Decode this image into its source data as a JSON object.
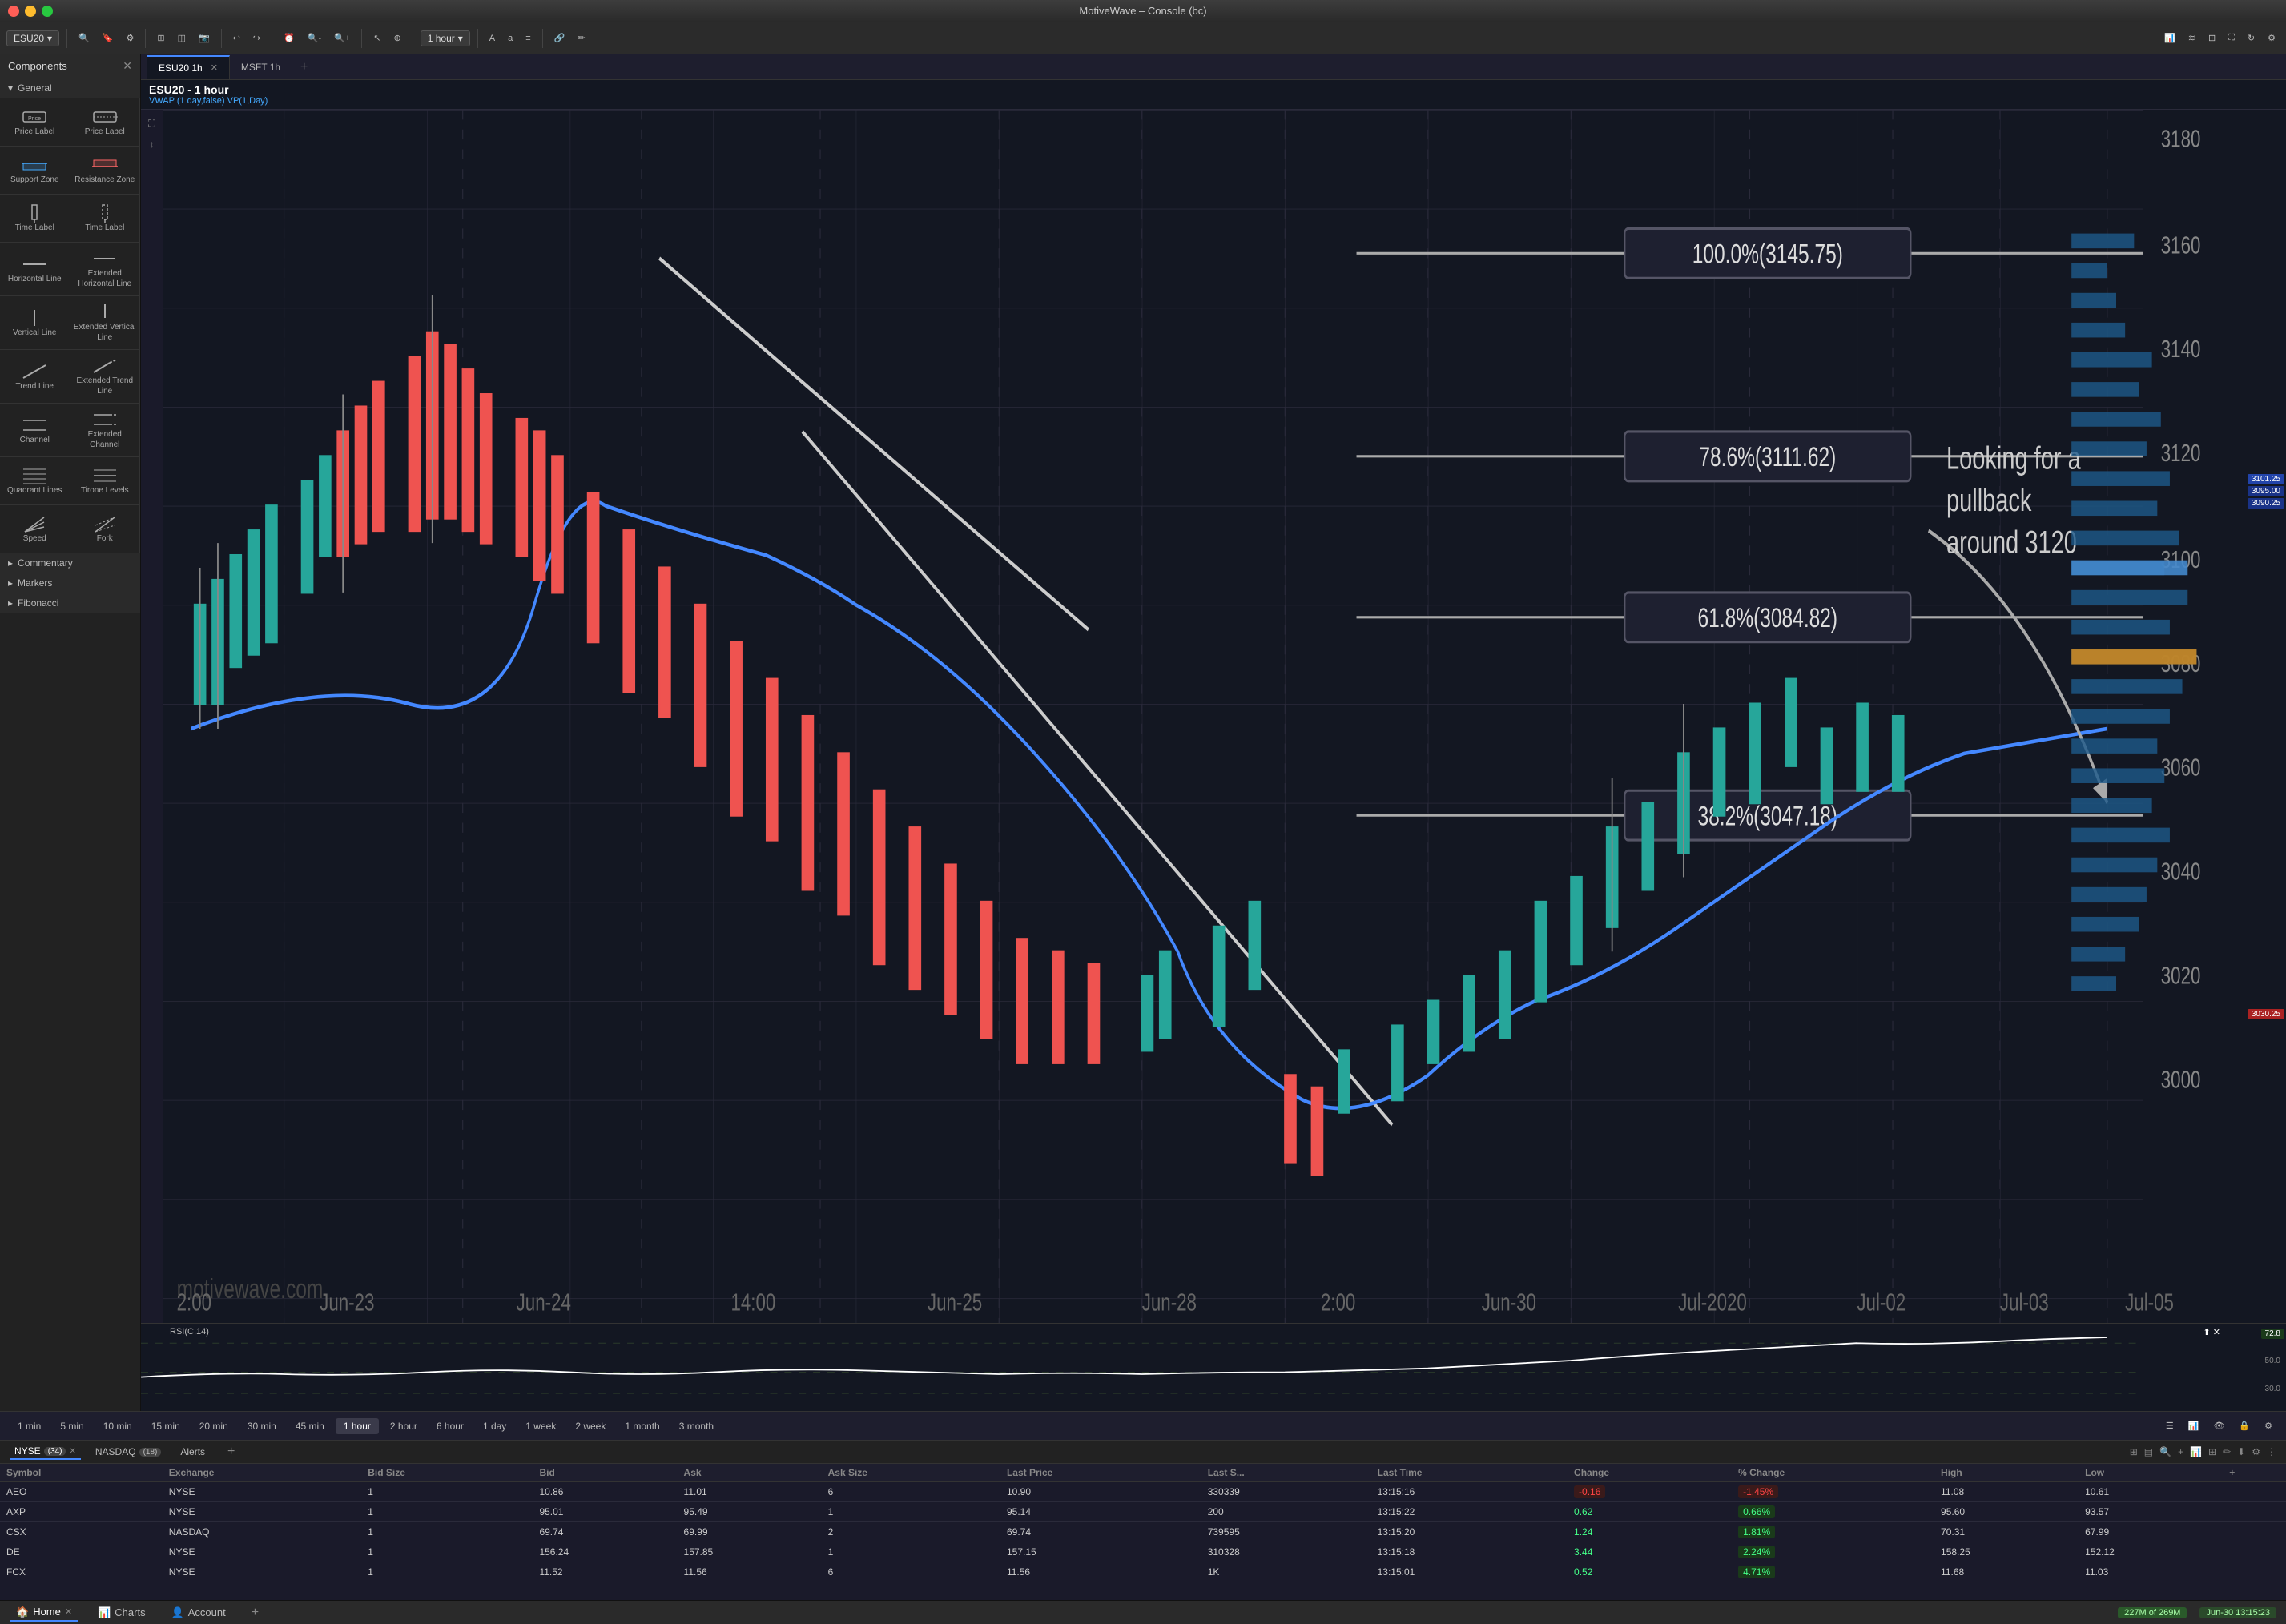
{
  "app": {
    "title": "MotiveWave – Console (bc)"
  },
  "titlebar": {
    "title": "MotiveWave – Console (bc)"
  },
  "toolbar": {
    "symbol": "ESU20",
    "timeframe": "1 hour",
    "timeframe_label": "hour"
  },
  "tabs": {
    "items": [
      {
        "label": "ESU20 1h",
        "active": true
      },
      {
        "label": "MSFT 1h",
        "active": false
      }
    ],
    "add_label": "+"
  },
  "chart": {
    "title": "ESU20 - 1 hour",
    "subtitle": "VWAP (1 day,false) VP(1,Day)",
    "fib_levels": [
      {
        "label": "100.0%(3145.75)",
        "y_pct": 18
      },
      {
        "label": "78.6%(3111.62)",
        "y_pct": 31
      },
      {
        "label": "61.8%(3084.82)",
        "y_pct": 42
      },
      {
        "label": "38.2%(3047.18)",
        "y_pct": 55
      }
    ],
    "annotation": "Looking for a\npullback\naround 3120",
    "watermark": "motivewave.com",
    "price_axis": {
      "values": [
        3180,
        3160,
        3140,
        3120,
        3100,
        3080,
        3060,
        3040,
        3020,
        3000
      ]
    },
    "current_price_badges": [
      {
        "value": "3101.25",
        "color": "blue"
      },
      {
        "value": "3095.00",
        "color": "blue"
      },
      {
        "value": "3090.25",
        "color": "blue"
      },
      {
        "value": "3030.25",
        "color": "red"
      }
    ],
    "x_axis": [
      "2:00",
      "Jun-23",
      "Jun-24",
      "14:00",
      "Jun-25",
      "Jun-28",
      "2:00",
      "Jun-30",
      "Jul-2020",
      "Jul-02",
      "Jul-03",
      "Jul-05"
    ]
  },
  "rsi": {
    "label": "RSI(C,14)",
    "value": "72.8",
    "levels": [
      72.8,
      50.0,
      30.0
    ]
  },
  "time_nav": {
    "buttons": [
      "1 min",
      "5 min",
      "10 min",
      "15 min",
      "20 min",
      "30 min",
      "45 min",
      "1 hour",
      "2 hour",
      "6 hour",
      "1 day",
      "1 week",
      "2 week",
      "1 month",
      "3 month"
    ],
    "active": "1 hour"
  },
  "sidebar": {
    "title": "Components",
    "sections": [
      {
        "name": "General",
        "items": [
          {
            "id": "price-label-1",
            "label": "Price Label",
            "icon": "price-label"
          },
          {
            "id": "price-label-2",
            "label": "Price Label",
            "icon": "price-label"
          },
          {
            "id": "support-zone",
            "label": "Support\nZone",
            "icon": "support"
          },
          {
            "id": "resistance-zone",
            "label": "Resistance\nZone",
            "icon": "resistance"
          },
          {
            "id": "time-label-1",
            "label": "Time Label",
            "icon": "time-label"
          },
          {
            "id": "time-label-2",
            "label": "Time Label",
            "icon": "time-label"
          },
          {
            "id": "horizontal-line",
            "label": "Horizontal\nLine",
            "icon": "hline"
          },
          {
            "id": "ext-horizontal-line",
            "label": "Extended\nHorizontal\nLine",
            "icon": "ext-hline"
          },
          {
            "id": "vertical-line",
            "label": "Vertical Line",
            "icon": "vline"
          },
          {
            "id": "ext-vertical-line",
            "label": "Extended\nVertical Line",
            "icon": "ext-vline"
          },
          {
            "id": "trend-line",
            "label": "Trend Line",
            "icon": "trendline"
          },
          {
            "id": "ext-trend-line",
            "label": "Extended\nTrend Line",
            "icon": "ext-trendline"
          },
          {
            "id": "channel",
            "label": "Channel",
            "icon": "channel"
          },
          {
            "id": "ext-channel",
            "label": "Extended\nChannel",
            "icon": "ext-channel"
          },
          {
            "id": "quadrant-lines",
            "label": "Quadrant\nLines",
            "icon": "quadrant"
          },
          {
            "id": "tirone-levels",
            "label": "Tirone\nLevels",
            "icon": "tirone"
          },
          {
            "id": "speed",
            "label": "Speed",
            "icon": "speed"
          },
          {
            "id": "fork",
            "label": "Fork",
            "icon": "fork"
          }
        ]
      },
      {
        "name": "Commentary",
        "items": []
      },
      {
        "name": "Markers",
        "items": []
      },
      {
        "name": "Fibonacci",
        "items": []
      }
    ]
  },
  "watchlist": {
    "tabs": [
      {
        "label": "NYSE",
        "count": 34,
        "active": true
      },
      {
        "label": "NASDAQ",
        "count": 18,
        "active": false
      },
      {
        "label": "Alerts",
        "count": null,
        "active": false
      }
    ],
    "columns": [
      "Symbol",
      "Exchange",
      "Bid Size",
      "Bid",
      "Ask",
      "Ask Size",
      "Last Price",
      "Last S...",
      "Last Time",
      "Change",
      "% Change",
      "High",
      "Low"
    ],
    "rows": [
      {
        "symbol": "AEO",
        "exchange": "NYSE",
        "bid_size": "1",
        "bid": "10.86",
        "ask": "11.01",
        "ask_size": "6",
        "last_price": "10.90",
        "last_s": "330339",
        "last_time": "13:15:16",
        "change": "-0.16",
        "pct_change": "-1.45%",
        "high": "11.08",
        "low": "10.61",
        "change_type": "neg"
      },
      {
        "symbol": "AXP",
        "exchange": "NYSE",
        "bid_size": "1",
        "bid": "95.01",
        "ask": "95.49",
        "ask_size": "1",
        "last_price": "95.14",
        "last_s": "200",
        "last_time": "13:15:22",
        "change": "0.62",
        "pct_change": "0.66%",
        "high": "95.60",
        "low": "93.57",
        "change_type": "pos"
      },
      {
        "symbol": "CSX",
        "exchange": "NASDAQ",
        "bid_size": "1",
        "bid": "69.74",
        "ask": "69.99",
        "ask_size": "2",
        "last_price": "69.74",
        "last_s": "739595",
        "last_time": "13:15:20",
        "change": "1.24",
        "pct_change": "1.81%",
        "high": "70.31",
        "low": "67.99",
        "change_type": "pos"
      },
      {
        "symbol": "DE",
        "exchange": "NYSE",
        "bid_size": "1",
        "bid": "156.24",
        "ask": "157.85",
        "ask_size": "1",
        "last_price": "157.15",
        "last_s": "310328",
        "last_time": "13:15:18",
        "change": "3.44",
        "pct_change": "2.24%",
        "high": "158.25",
        "low": "152.12",
        "change_type": "pos"
      },
      {
        "symbol": "FCX",
        "exchange": "NYSE",
        "bid_size": "1",
        "bid": "11.52",
        "ask": "11.56",
        "ask_size": "6",
        "last_price": "11.56",
        "last_s": "1K",
        "last_time": "13:15:01",
        "change": "0.52",
        "pct_change": "4.71%",
        "high": "11.68",
        "low": "11.03",
        "change_type": "pos"
      }
    ]
  },
  "bottom_bar": {
    "tabs": [
      {
        "label": "Home",
        "icon": "home",
        "closeable": true,
        "active": true
      },
      {
        "label": "Charts",
        "icon": "charts",
        "closeable": false,
        "active": false
      },
      {
        "label": "Account",
        "icon": "account",
        "closeable": false,
        "active": false
      }
    ],
    "add_label": "+",
    "memory": "227M of 269M",
    "datetime": "Jun-30 13:15:23"
  }
}
